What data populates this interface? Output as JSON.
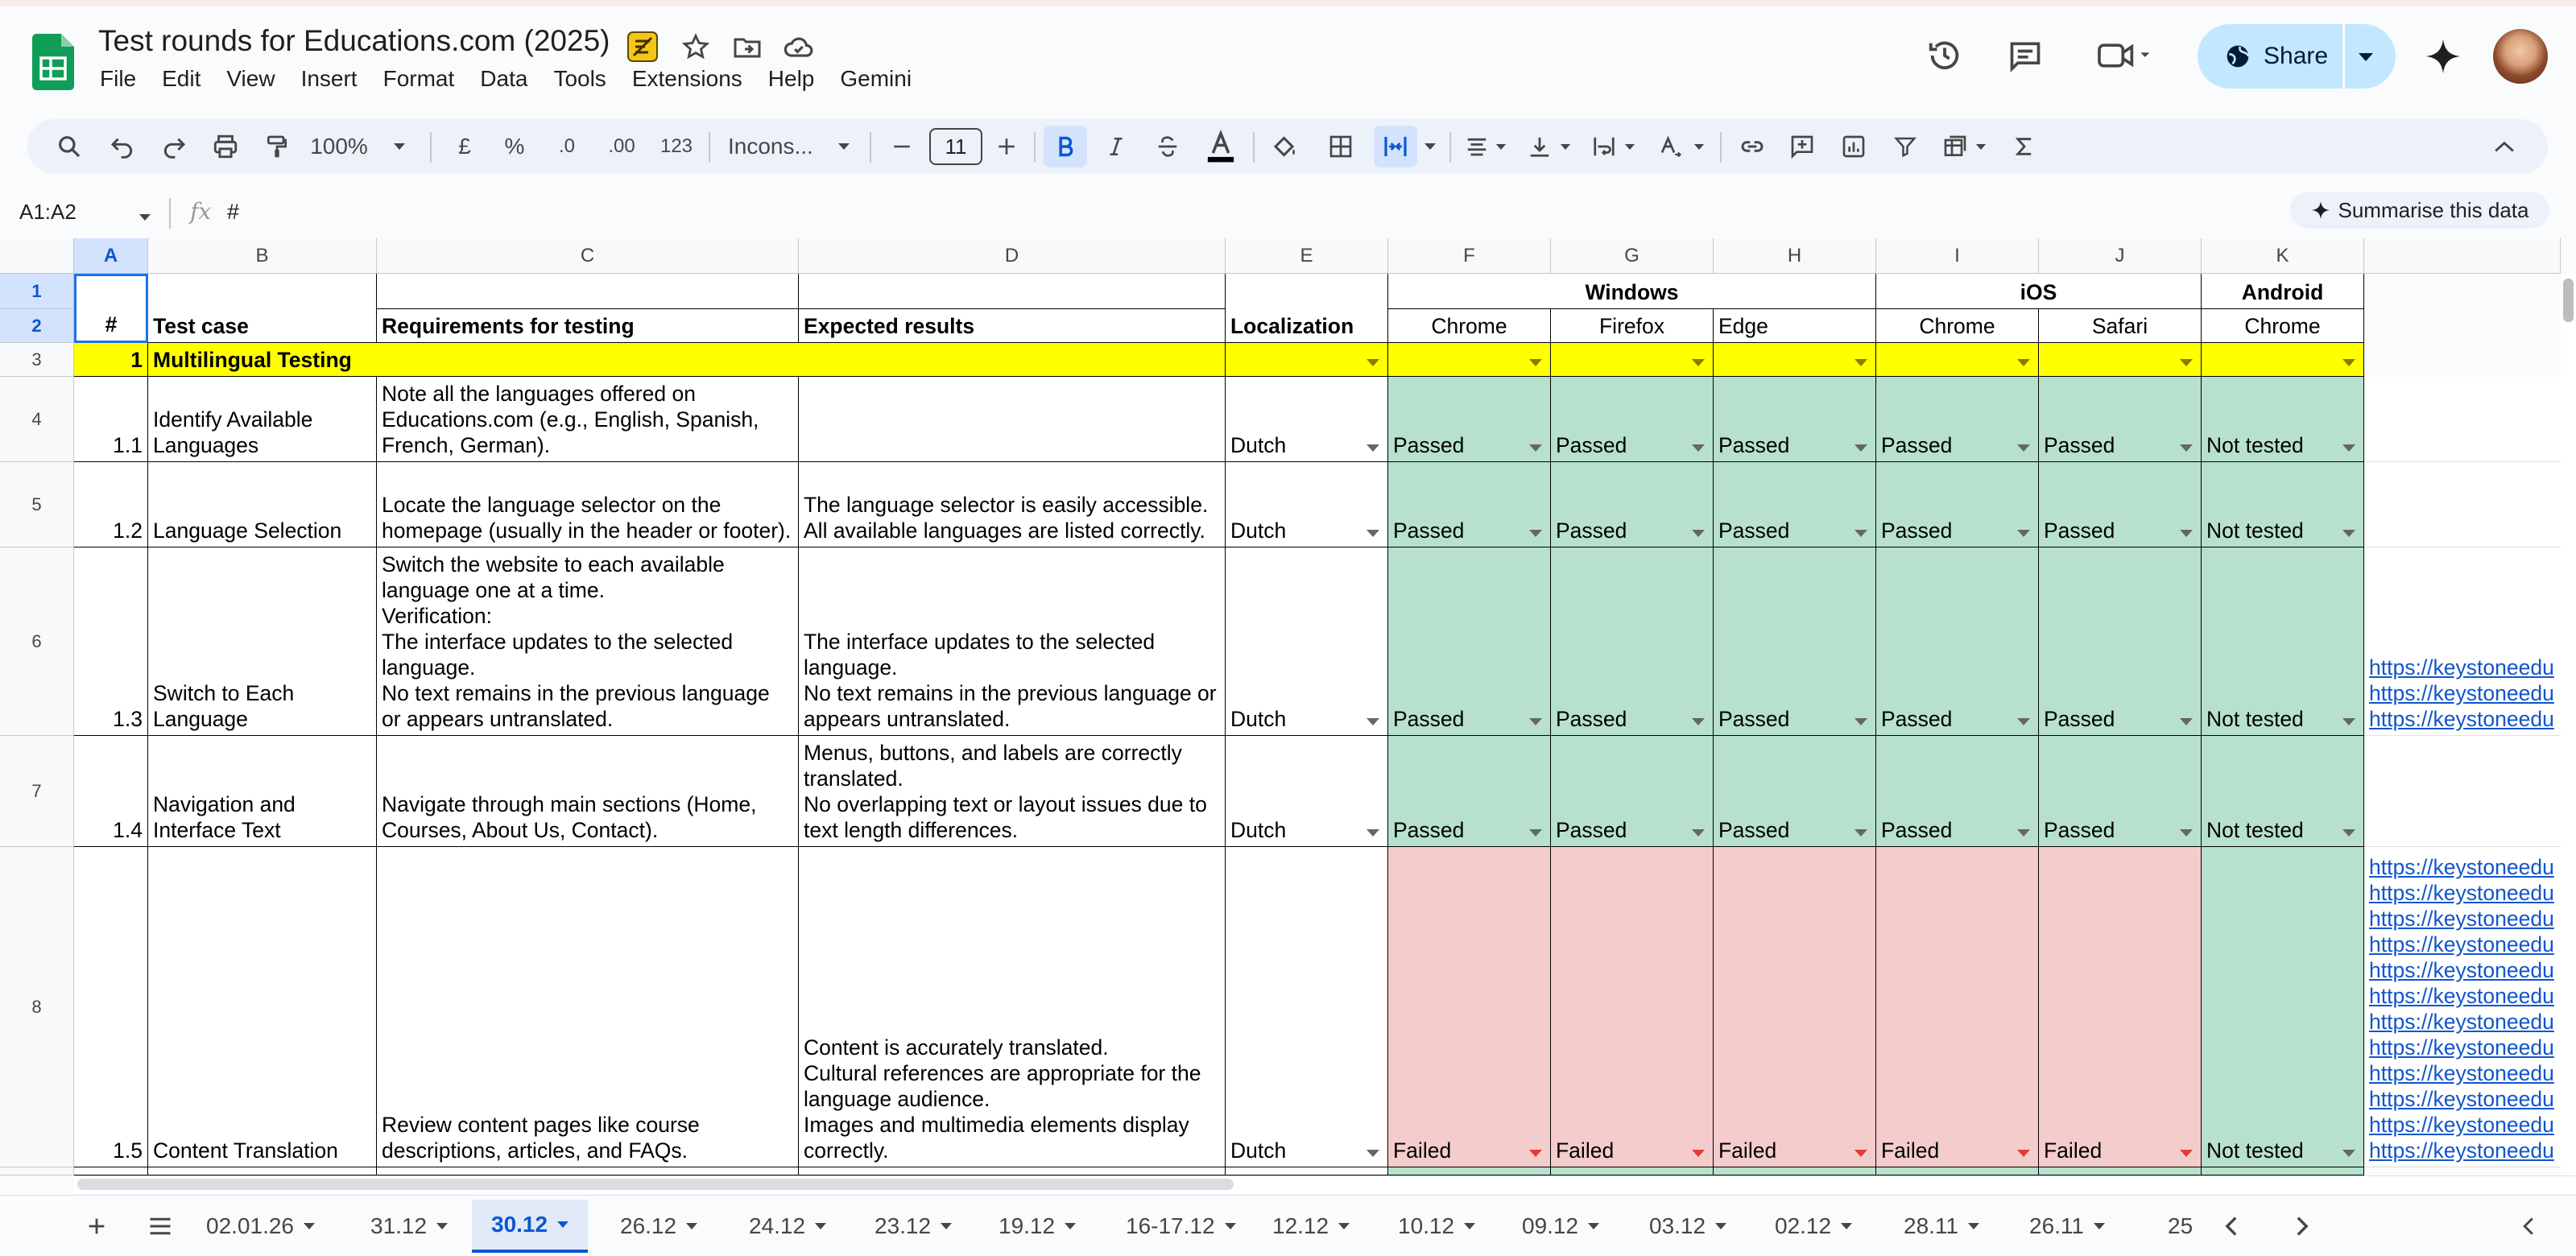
{
  "doc": {
    "title": "Test rounds for Educations.com (2025)"
  },
  "menus": [
    "File",
    "Edit",
    "View",
    "Insert",
    "Format",
    "Data",
    "Tools",
    "Extensions",
    "Help",
    "Gemini"
  ],
  "share_label": "Share",
  "toolbar": {
    "zoom": "100%",
    "currency": "£",
    "percent": "%",
    "dec_less": ".0",
    "dec_more": ".00",
    "number_format": "123",
    "font": "Incons...",
    "font_size": "11"
  },
  "formula": {
    "namebox": "A1:A2",
    "fx": "fx",
    "value": "#"
  },
  "summarise_label": "Summarise this data",
  "columns": [
    "A",
    "B",
    "C",
    "D",
    "E",
    "F",
    "G",
    "H",
    "I",
    "J",
    "K"
  ],
  "rows": [
    "1",
    "2",
    "3",
    "4",
    "5",
    "6",
    "7",
    "8"
  ],
  "header": {
    "num": "#",
    "test_case": "Test case",
    "requirements": "Requirements for testing",
    "expected": "Expected results",
    "localization": "Localization",
    "windows": "Windows",
    "ios": "iOS",
    "android": "Android",
    "win_chrome": "Chrome",
    "win_firefox": "Firefox",
    "win_edge": "Edge",
    "ios_chrome": "Chrome",
    "ios_safari": "Safari",
    "and_chrome": "Chrome"
  },
  "section": {
    "num": "1",
    "title": "Multilingual Testing"
  },
  "cases": [
    {
      "num": "1.1",
      "name": "Identify Available Languages",
      "req": "Note all the languages offered on Educations.com (e.g., English, Spanish, French, German).",
      "exp": "",
      "loc": "Dutch",
      "results": [
        "Passed",
        "Passed",
        "Passed",
        "Passed",
        "Passed",
        "Not tested"
      ],
      "links": []
    },
    {
      "num": "1.2",
      "name": "Language Selection",
      "req": "Locate the language selector on the homepage (usually in the header or footer).",
      "exp": "The language selector is easily accessible.\nAll available languages are listed correctly.",
      "loc": "Dutch",
      "results": [
        "Passed",
        "Passed",
        "Passed",
        "Passed",
        "Passed",
        "Not tested"
      ],
      "links": []
    },
    {
      "num": "1.3",
      "name": "Switch to Each Language",
      "req": "Switch the website to each available language one at a time.\nVerification:\nThe interface updates to the selected language.\nNo text remains in the previous language or appears untranslated.",
      "exp": "The interface updates to the selected language.\nNo text remains in the previous language or appears untranslated.",
      "loc": "Dutch",
      "results": [
        "Passed",
        "Passed",
        "Passed",
        "Passed",
        "Passed",
        "Not tested"
      ],
      "links": [
        "https://keystoneedu",
        "https://keystoneedu",
        "https://keystoneedu"
      ]
    },
    {
      "num": "1.4",
      "name": "Navigation and Interface Text",
      "req": "Navigate through main sections (Home, Courses, About Us, Contact).",
      "exp": "Menus, buttons, and labels are correctly translated.\nNo overlapping text or layout issues due to text length differences.",
      "loc": "Dutch",
      "results": [
        "Passed",
        "Passed",
        "Passed",
        "Passed",
        "Passed",
        "Not tested"
      ],
      "links": []
    },
    {
      "num": "1.5",
      "name": "Content Translation",
      "req": "Review content pages like course descriptions, articles, and FAQs.",
      "exp": "Content is accurately translated.\nCultural references are appropriate for the language audience.\n Images and multimedia elements display correctly.",
      "loc": "Dutch",
      "results": [
        "Failed",
        "Failed",
        "Failed",
        "Failed",
        "Failed",
        "Not tested"
      ],
      "links": [
        "https://keystoneedu",
        "https://keystoneedu",
        "https://keystoneedu",
        "https://keystoneedu",
        "https://keystoneedu",
        "https://keystoneedu",
        "https://keystoneedu",
        "https://keystoneedu",
        "https://keystoneedu",
        "https://keystoneedu",
        "https://keystoneedu",
        "https://keystoneedu"
      ]
    }
  ],
  "tabs": [
    "02.01.26",
    "31.12",
    "30.12",
    "26.12",
    "24.12",
    "23.12",
    "19.12",
    "16-17.12",
    "12.12",
    "10.12",
    "09.12",
    "03.12",
    "02.12",
    "28.11",
    "26.11",
    "25"
  ],
  "active_tab": "30.12",
  "colors": {
    "passed": "#b7e1cd",
    "failed": "#f4cccc",
    "section": "#ffff00",
    "share": "#c2e7ff",
    "accent": "#0b57d0"
  }
}
